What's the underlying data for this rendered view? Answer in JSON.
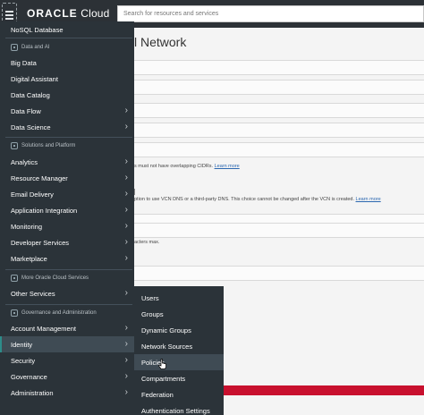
{
  "topbar": {
    "logo_bold": "ORACLE",
    "logo_light": " Cloud",
    "search_placeholder": "Search for resources and services"
  },
  "page": {
    "title_fragment": "l Network",
    "hint_cidr": "s must not have overlapping CIDRs.",
    "hint_dns": "ption to use VCN DNS or a third-party DNS. This choice cannot be changed after the VCN is created.",
    "learn_more": "Learn more",
    "hint_letters": "acters max."
  },
  "sidebar": {
    "top_item": "NoSQL Database",
    "cat_data_ai": "Data and AI",
    "data_items": [
      "Big Data",
      "Digital Assistant",
      "Data Catalog",
      "Data Flow",
      "Data Science"
    ],
    "cat_solutions": "Solutions and Platform",
    "solutions_items": [
      "Analytics",
      "Resource Manager",
      "Email Delivery",
      "Application Integration",
      "Monitoring",
      "Developer Services",
      "Marketplace"
    ],
    "cat_more": "More Oracle Cloud Services",
    "more_items": [
      "Other Services"
    ],
    "cat_governance": "Governance and Administration",
    "gov_items": [
      "Account Management",
      "Identity",
      "Security",
      "Governance",
      "Administration"
    ]
  },
  "submenu": {
    "items": [
      "Users",
      "Groups",
      "Dynamic Groups",
      "Network Sources",
      "Policies",
      "Compartments",
      "Federation",
      "Authentication Settings"
    ],
    "hovered": "Policies"
  },
  "icons": {
    "chevron": "›",
    "menu": "hamburger-icon"
  },
  "colors": {
    "topbar": "#2c3136",
    "sidebar": "#2b3339",
    "active_accent": "#2d8c8a",
    "alert_bar": "#c8102e",
    "link": "#2b67b0"
  }
}
